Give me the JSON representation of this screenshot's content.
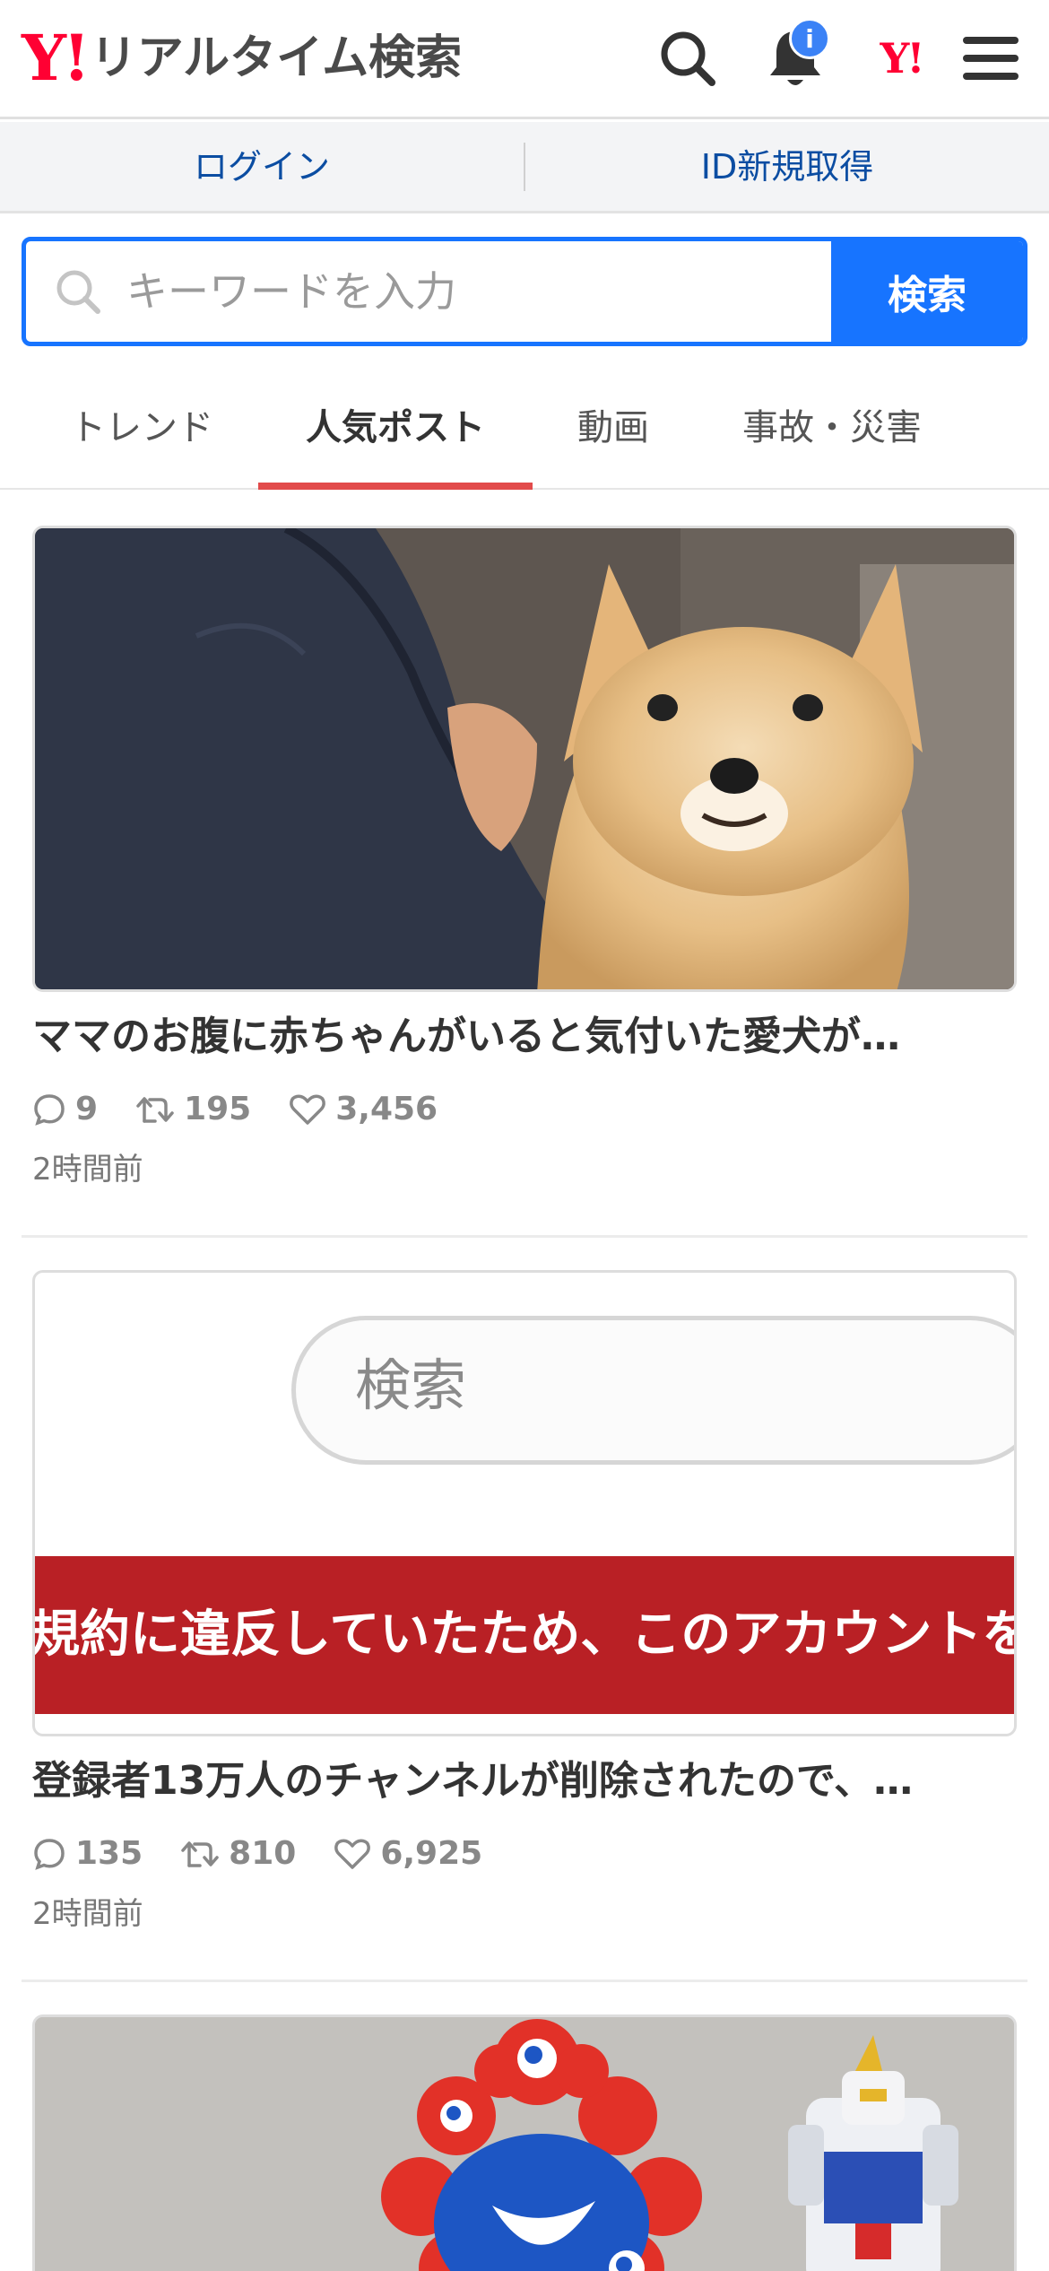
{
  "header": {
    "logo_mark": "Y!",
    "logo_text": "リアルタイム検索",
    "notification_badge": "i",
    "yahoo_mark": "Y!"
  },
  "account": {
    "login_label": "ログイン",
    "register_label": "ID新規取得"
  },
  "search": {
    "placeholder": "キーワードを入力",
    "button_label": "検索"
  },
  "tabs": [
    {
      "label": "トレンド",
      "active": false
    },
    {
      "label": "人気ポスト",
      "active": true
    },
    {
      "label": "動画",
      "active": false
    },
    {
      "label": "事故・災害",
      "active": false
    }
  ],
  "posts": [
    {
      "title": "ママのお腹に赤ちゃんがいると気付いた愛犬が…",
      "replies": "9",
      "reposts": "195",
      "likes": "3,456",
      "time": "2時間前",
      "image": "photo of a pomeranian dog sitting beside a person"
    },
    {
      "title": "登録者13万人のチャンネルが削除されたので、…",
      "replies": "135",
      "reposts": "810",
      "likes": "6,925",
      "time": "2時間前",
      "image": "screenshot with search box and red banner",
      "image_search_text": "検索",
      "image_banner_text": "規約に違反していたため、このアカウントを"
    },
    {
      "image": "photo of a red mascot figure and a robot model"
    }
  ],
  "colors": {
    "accent": "#1774ff",
    "brand": "#ff0033",
    "tab_indicator": "#e24b4b",
    "link": "#0b4da2",
    "banner_red": "#b92025"
  }
}
